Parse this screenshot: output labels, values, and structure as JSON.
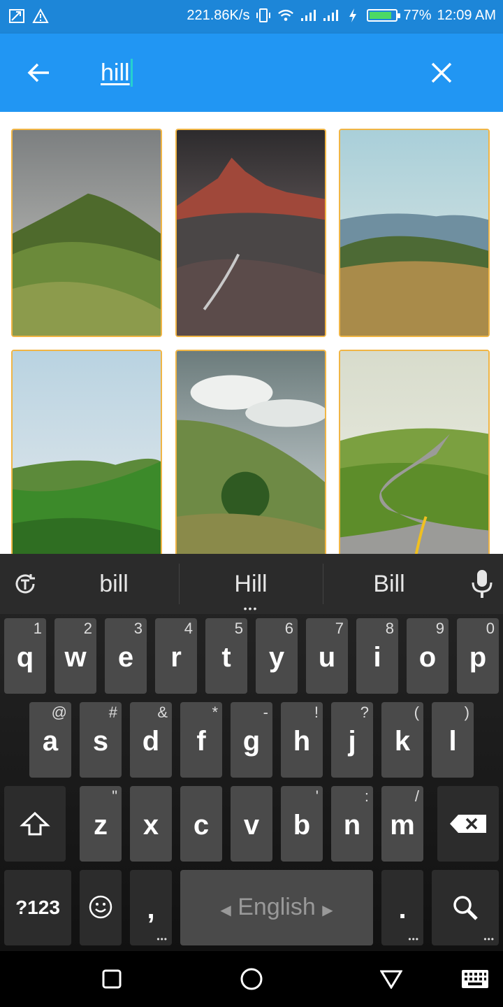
{
  "status_bar": {
    "speed": "221.86K/s",
    "battery": "77%",
    "battery_level": 0.77,
    "time": "12:09 AM"
  },
  "search": {
    "query": "hill"
  },
  "results": [
    {
      "scene": "green-mountain-ridge-cloudy"
    },
    {
      "scene": "red-peak-rocky-stream"
    },
    {
      "scene": "distant-blue-hills-golden-grass"
    },
    {
      "scene": "misty-green-slopes"
    },
    {
      "scene": "hillside-with-tree-and-clouds"
    },
    {
      "scene": "winding-road-over-hills"
    }
  ],
  "keyboard": {
    "suggestions": [
      "bill",
      "Hill",
      "Bill"
    ],
    "row1": [
      {
        "key": "q",
        "hint": "1"
      },
      {
        "key": "w",
        "hint": "2"
      },
      {
        "key": "e",
        "hint": "3"
      },
      {
        "key": "r",
        "hint": "4"
      },
      {
        "key": "t",
        "hint": "5"
      },
      {
        "key": "y",
        "hint": "6"
      },
      {
        "key": "u",
        "hint": "7"
      },
      {
        "key": "i",
        "hint": "8"
      },
      {
        "key": "o",
        "hint": "9"
      },
      {
        "key": "p",
        "hint": "0"
      }
    ],
    "row2": [
      {
        "key": "a",
        "hint": "@"
      },
      {
        "key": "s",
        "hint": "#"
      },
      {
        "key": "d",
        "hint": "&"
      },
      {
        "key": "f",
        "hint": "*"
      },
      {
        "key": "g",
        "hint": "-"
      },
      {
        "key": "h",
        "hint": "!"
      },
      {
        "key": "j",
        "hint": "?"
      },
      {
        "key": "k",
        "hint": "("
      },
      {
        "key": "l",
        "hint": ")"
      }
    ],
    "row3": [
      {
        "key": "z",
        "hint": "\""
      },
      {
        "key": "x",
        "hint": ""
      },
      {
        "key": "c",
        "hint": ""
      },
      {
        "key": "v",
        "hint": ""
      },
      {
        "key": "b",
        "hint": "'"
      },
      {
        "key": "n",
        "hint": ":"
      },
      {
        "key": "m",
        "hint": "/"
      }
    ],
    "symbols_label": "?123",
    "comma": ",",
    "space_label": "English",
    "period": "."
  },
  "colors": {
    "status_bar": "#1d86d8",
    "app_bar": "#2196f3",
    "tile_border": "#f0b545",
    "caret": "#26d0ce"
  }
}
